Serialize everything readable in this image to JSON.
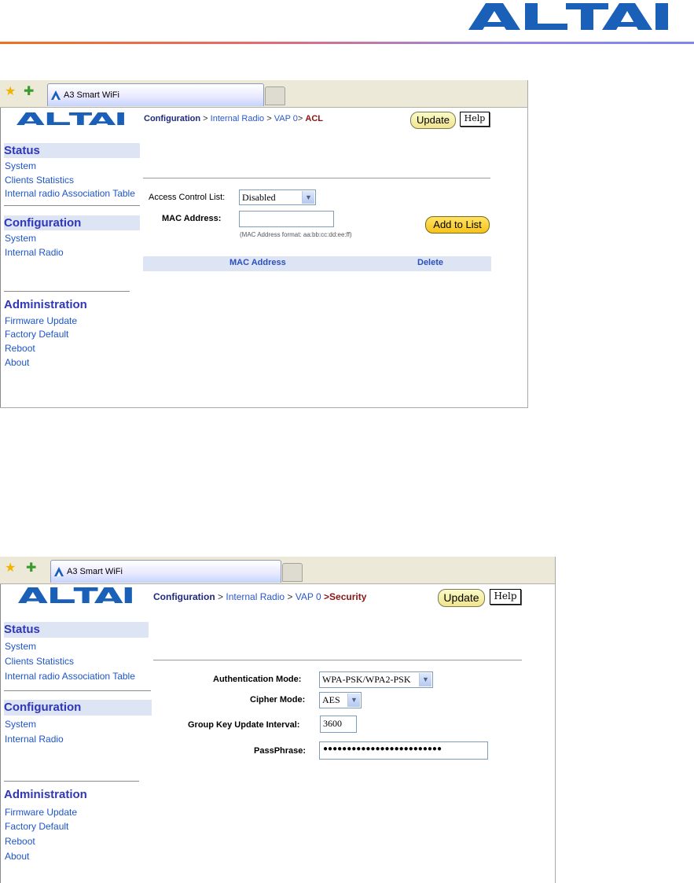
{
  "brand": {
    "logo_text": "ALTAI",
    "accent": "#1a5fb8",
    "rule_colors": [
      "#f07020",
      "#7f86f0"
    ]
  },
  "browser": {
    "tab_title": "A3 Smart WiFi",
    "icons": [
      "favorites-star-icon",
      "add-favorite-icon",
      "altai-favicon"
    ]
  },
  "sidebar": {
    "status_heading": "Status",
    "status_items": [
      "System",
      "Clients Statistics",
      "Internal radio Association Table"
    ],
    "config_heading": "Configuration",
    "config_items": [
      "System",
      "Internal Radio"
    ],
    "admin_heading": "Administration",
    "admin_items": [
      "Firmware Update",
      "Factory Default",
      "Reboot",
      "About"
    ]
  },
  "buttons": {
    "update": "Update",
    "help": "Help",
    "add_to_list": "Add to List"
  },
  "acl_screen": {
    "breadcrumb": {
      "root": "Configuration",
      "sep": ">",
      "radio": "Internal Radio",
      "vap": "VAP 0",
      "current": "ACL"
    },
    "acl_label": "Access Control List:",
    "acl_value": "Disabled",
    "mac_label": "MAC Address:",
    "mac_value": "",
    "mac_hint": "(MAC Address format: aa:bb:cc:dd:ee:ff)",
    "table_headers": [
      "MAC Address",
      "Delete"
    ]
  },
  "security_screen": {
    "breadcrumb": {
      "root": "Configuration",
      "sep": ">",
      "radio": "Internal Radio",
      "vap": "VAP 0",
      "current": ">Security"
    },
    "auth_label": "Authentication Mode:",
    "auth_value": "WPA-PSK/WPA2-PSK",
    "cipher_label": "Cipher Mode:",
    "cipher_value": "AES",
    "gkui_label": "Group Key Update Interval:",
    "gkui_value": "3600",
    "pass_label": "PassPhrase:",
    "pass_value": "●●●●●●●●●●●●●●●●●●●●●●●●●"
  }
}
